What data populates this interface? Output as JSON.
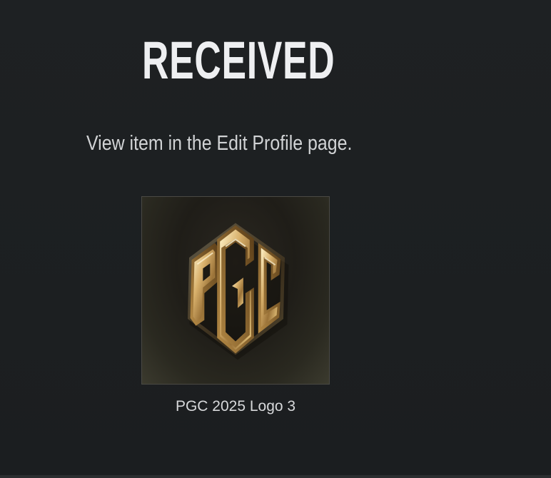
{
  "dialog": {
    "title": "RECEIVED",
    "message": "View item in the Edit Profile page."
  },
  "item": {
    "name": "PGC 2025 Logo 3",
    "emblem_text": "PGC",
    "icon": "pgc-monogram-emblem",
    "colors": {
      "gold_light": "#f4dfa6",
      "gold_mid": "#c9a05a",
      "gold_dark": "#6f4f24"
    }
  },
  "colors": {
    "background": "#1c1f21",
    "title": "#eeeff1",
    "text": "#d1d3d5"
  }
}
